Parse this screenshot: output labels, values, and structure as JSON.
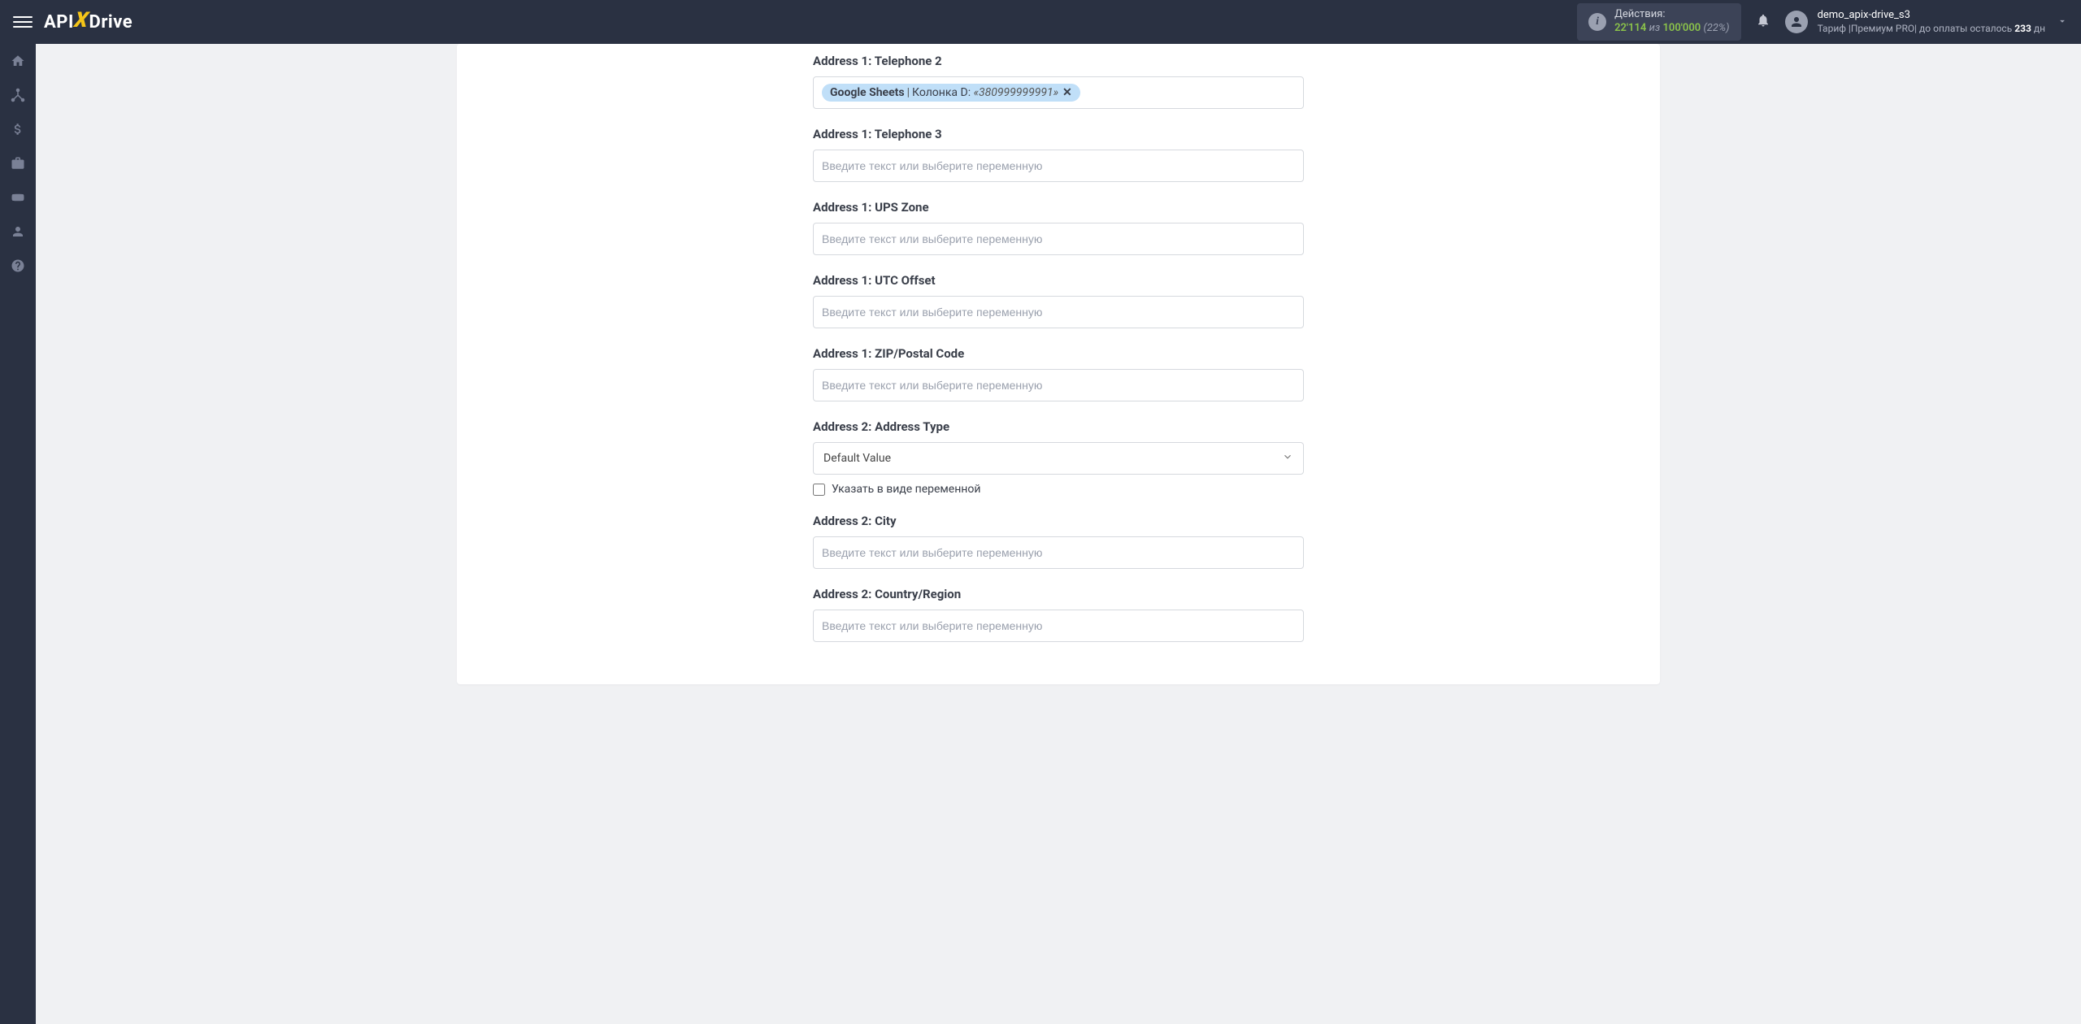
{
  "header": {
    "logo_part1": "API",
    "logo_part2": "Drive",
    "actions": {
      "label": "Действия:",
      "used": "22'114",
      "sep": "из",
      "total": "100'000",
      "percent": "(22%)"
    },
    "user": {
      "name": "demo_apix-drive_s3",
      "tariff_prefix": "Тариф |",
      "tariff_name": "Премиум PRO",
      "days_prefix": "| до оплаты осталось ",
      "days_count": "233",
      "days_suffix": " дн"
    }
  },
  "form": {
    "placeholder": "Введите текст или выберите переменную",
    "fields": [
      {
        "label": "Address 1: Telephone 2",
        "chip": {
          "source": "Google Sheets",
          "column": "Колонка D:",
          "value": "«380999999991»"
        }
      },
      {
        "label": "Address 1: Telephone 3"
      },
      {
        "label": "Address 1: UPS Zone"
      },
      {
        "label": "Address 1: UTC Offset"
      },
      {
        "label": "Address 1: ZIP/Postal Code"
      },
      {
        "label": "Address 2: Address Type",
        "select": "Default Value",
        "checkbox_label": "Указать в виде переменной"
      },
      {
        "label": "Address 2: City"
      },
      {
        "label": "Address 2: Country/Region"
      }
    ]
  }
}
